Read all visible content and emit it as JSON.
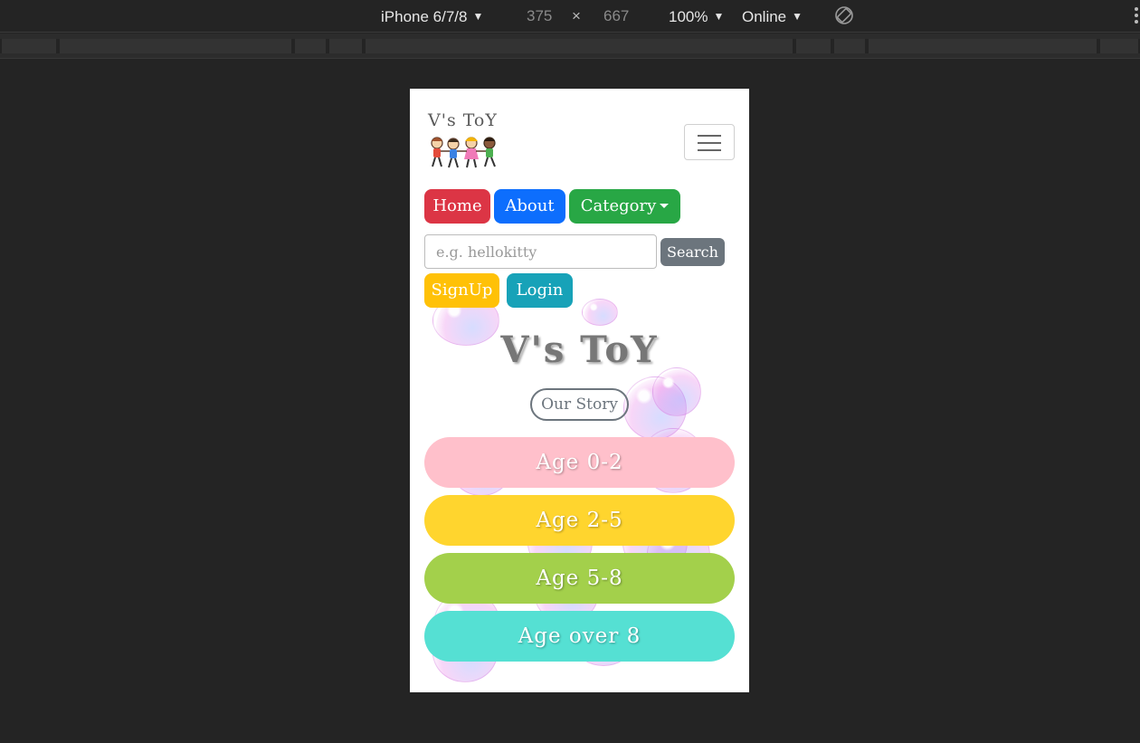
{
  "devtools": {
    "device": "iPhone 6/7/8",
    "width": "375",
    "times": "×",
    "height": "667",
    "zoom": "100%",
    "network": "Online",
    "caret": "▼"
  },
  "site": {
    "brand": "V's ToY",
    "nav": {
      "home": "Home",
      "about": "About",
      "category": "Category"
    },
    "search": {
      "placeholder": "e.g. hellokitty",
      "button": "Search"
    },
    "auth": {
      "signup": "SignUp",
      "login": "Login"
    },
    "hero_title": "V's ToY",
    "story_button": "Our Story",
    "ages": [
      "Age 0-2",
      "Age 2-5",
      "Age 5-8",
      "Age over 8"
    ]
  },
  "colors": {
    "home": "#dc3545",
    "about": "#0d6efd",
    "category": "#28a745",
    "search": "#6c757d",
    "signup": "#ffc107",
    "login": "#17a2b8",
    "age_0_2": "#ffc0cb",
    "age_2_5": "#ffd52e",
    "age_5_8": "#a3d04b",
    "age_over_8": "#55e0d3"
  }
}
